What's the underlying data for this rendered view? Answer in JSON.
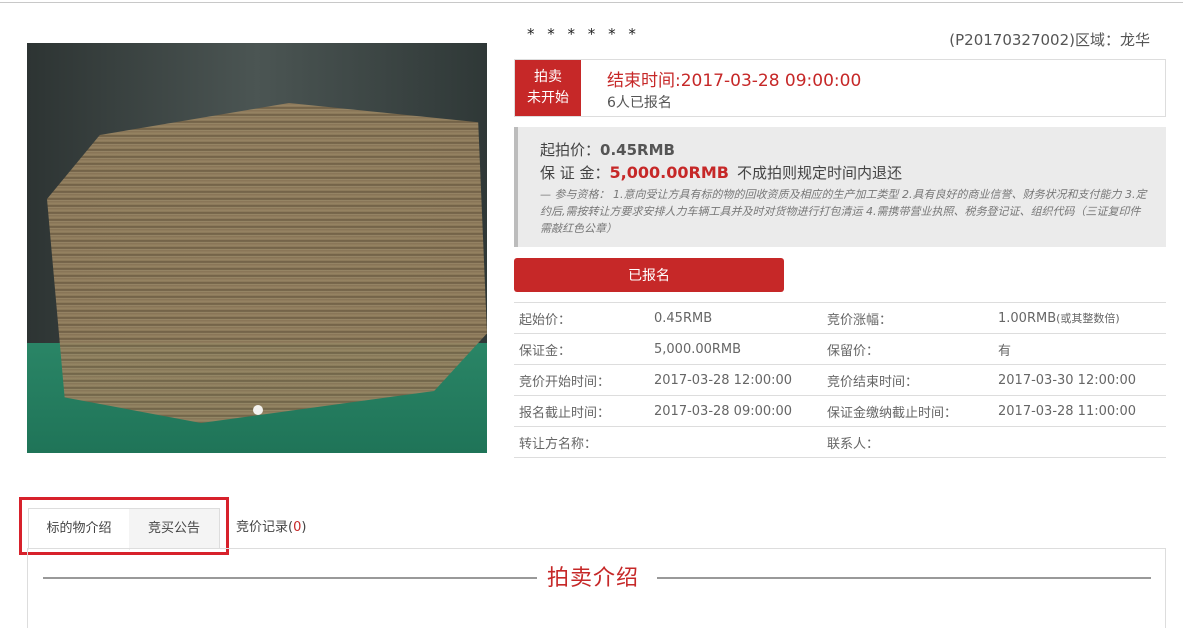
{
  "item": {
    "masked_name": "* * * * * *",
    "code_region": "(P20170327002)区域：龙华"
  },
  "photo": {
    "alt": "cardboard-stack-photo"
  },
  "status": {
    "badge_line1": "拍卖",
    "badge_line2": "未开始",
    "end_time": "结束时间:2017-03-28 09:00:00",
    "signed_count": "6人已报名"
  },
  "pricing": {
    "start_price_label": "起拍价：",
    "start_price_value": "0.45RMB",
    "deposit_label": "保 证 金：",
    "deposit_value": "5,000.00RMB",
    "deposit_note": "不成拍则规定时间内退还",
    "qualification": "— 参与资格： 1.意向受让方具有标的物的回收资质及相应的生产加工类型 2.具有良好的商业信誉、财务状况和支付能力 3.定约后,需按转让方要求安排人力车辆工具并及时对货物进行打包清运 4.需携带营业执照、税务登记证、组织代码（三证复印件需敲红色公章）"
  },
  "actions": {
    "signed_button": "已报名"
  },
  "info_table": [
    [
      "起始价：",
      "0.45RMB",
      "竞价涨幅：",
      "1.00RMB",
      "(或其整数倍)"
    ],
    [
      "保证金：",
      "5,000.00RMB",
      "保留价：",
      "有",
      ""
    ],
    [
      "竞价开始时间：",
      "2017-03-28 12:00:00",
      "竞价结束时间：",
      "2017-03-30 12:00:00",
      ""
    ],
    [
      "报名截止时间：",
      "2017-03-28 09:00:00",
      "保证金缴纳截止时间：",
      "2017-03-28 11:00:00",
      ""
    ],
    [
      "转让方名称：",
      "",
      "联系人：",
      "",
      ""
    ]
  ],
  "tabs": {
    "intro": "标的物介绍",
    "announcement": "竞买公告",
    "bid_record": "竞价记录(",
    "bid_count": "0",
    "bid_close": ")"
  },
  "section": {
    "title": "拍卖介绍"
  },
  "colors": {
    "accent": "#c62828",
    "highlight_border": "#d7212b"
  }
}
